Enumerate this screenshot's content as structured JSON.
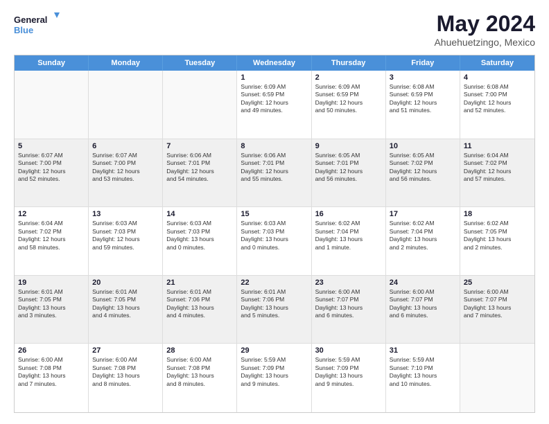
{
  "logo": {
    "line1": "General",
    "line2": "Blue"
  },
  "title": "May 2024",
  "subtitle": "Ahuehuetzingo, Mexico",
  "days": [
    "Sunday",
    "Monday",
    "Tuesday",
    "Wednesday",
    "Thursday",
    "Friday",
    "Saturday"
  ],
  "weeks": [
    [
      {
        "day": "",
        "info": ""
      },
      {
        "day": "",
        "info": ""
      },
      {
        "day": "",
        "info": ""
      },
      {
        "day": "1",
        "info": "Sunrise: 6:09 AM\nSunset: 6:59 PM\nDaylight: 12 hours\nand 49 minutes."
      },
      {
        "day": "2",
        "info": "Sunrise: 6:09 AM\nSunset: 6:59 PM\nDaylight: 12 hours\nand 50 minutes."
      },
      {
        "day": "3",
        "info": "Sunrise: 6:08 AM\nSunset: 6:59 PM\nDaylight: 12 hours\nand 51 minutes."
      },
      {
        "day": "4",
        "info": "Sunrise: 6:08 AM\nSunset: 7:00 PM\nDaylight: 12 hours\nand 52 minutes."
      }
    ],
    [
      {
        "day": "5",
        "info": "Sunrise: 6:07 AM\nSunset: 7:00 PM\nDaylight: 12 hours\nand 52 minutes."
      },
      {
        "day": "6",
        "info": "Sunrise: 6:07 AM\nSunset: 7:00 PM\nDaylight: 12 hours\nand 53 minutes."
      },
      {
        "day": "7",
        "info": "Sunrise: 6:06 AM\nSunset: 7:01 PM\nDaylight: 12 hours\nand 54 minutes."
      },
      {
        "day": "8",
        "info": "Sunrise: 6:06 AM\nSunset: 7:01 PM\nDaylight: 12 hours\nand 55 minutes."
      },
      {
        "day": "9",
        "info": "Sunrise: 6:05 AM\nSunset: 7:01 PM\nDaylight: 12 hours\nand 56 minutes."
      },
      {
        "day": "10",
        "info": "Sunrise: 6:05 AM\nSunset: 7:02 PM\nDaylight: 12 hours\nand 56 minutes."
      },
      {
        "day": "11",
        "info": "Sunrise: 6:04 AM\nSunset: 7:02 PM\nDaylight: 12 hours\nand 57 minutes."
      }
    ],
    [
      {
        "day": "12",
        "info": "Sunrise: 6:04 AM\nSunset: 7:02 PM\nDaylight: 12 hours\nand 58 minutes."
      },
      {
        "day": "13",
        "info": "Sunrise: 6:03 AM\nSunset: 7:03 PM\nDaylight: 12 hours\nand 59 minutes."
      },
      {
        "day": "14",
        "info": "Sunrise: 6:03 AM\nSunset: 7:03 PM\nDaylight: 13 hours\nand 0 minutes."
      },
      {
        "day": "15",
        "info": "Sunrise: 6:03 AM\nSunset: 7:03 PM\nDaylight: 13 hours\nand 0 minutes."
      },
      {
        "day": "16",
        "info": "Sunrise: 6:02 AM\nSunset: 7:04 PM\nDaylight: 13 hours\nand 1 minute."
      },
      {
        "day": "17",
        "info": "Sunrise: 6:02 AM\nSunset: 7:04 PM\nDaylight: 13 hours\nand 2 minutes."
      },
      {
        "day": "18",
        "info": "Sunrise: 6:02 AM\nSunset: 7:05 PM\nDaylight: 13 hours\nand 2 minutes."
      }
    ],
    [
      {
        "day": "19",
        "info": "Sunrise: 6:01 AM\nSunset: 7:05 PM\nDaylight: 13 hours\nand 3 minutes."
      },
      {
        "day": "20",
        "info": "Sunrise: 6:01 AM\nSunset: 7:05 PM\nDaylight: 13 hours\nand 4 minutes."
      },
      {
        "day": "21",
        "info": "Sunrise: 6:01 AM\nSunset: 7:06 PM\nDaylight: 13 hours\nand 4 minutes."
      },
      {
        "day": "22",
        "info": "Sunrise: 6:01 AM\nSunset: 7:06 PM\nDaylight: 13 hours\nand 5 minutes."
      },
      {
        "day": "23",
        "info": "Sunrise: 6:00 AM\nSunset: 7:07 PM\nDaylight: 13 hours\nand 6 minutes."
      },
      {
        "day": "24",
        "info": "Sunrise: 6:00 AM\nSunset: 7:07 PM\nDaylight: 13 hours\nand 6 minutes."
      },
      {
        "day": "25",
        "info": "Sunrise: 6:00 AM\nSunset: 7:07 PM\nDaylight: 13 hours\nand 7 minutes."
      }
    ],
    [
      {
        "day": "26",
        "info": "Sunrise: 6:00 AM\nSunset: 7:08 PM\nDaylight: 13 hours\nand 7 minutes."
      },
      {
        "day": "27",
        "info": "Sunrise: 6:00 AM\nSunset: 7:08 PM\nDaylight: 13 hours\nand 8 minutes."
      },
      {
        "day": "28",
        "info": "Sunrise: 6:00 AM\nSunset: 7:08 PM\nDaylight: 13 hours\nand 8 minutes."
      },
      {
        "day": "29",
        "info": "Sunrise: 5:59 AM\nSunset: 7:09 PM\nDaylight: 13 hours\nand 9 minutes."
      },
      {
        "day": "30",
        "info": "Sunrise: 5:59 AM\nSunset: 7:09 PM\nDaylight: 13 hours\nand 9 minutes."
      },
      {
        "day": "31",
        "info": "Sunrise: 5:59 AM\nSunset: 7:10 PM\nDaylight: 13 hours\nand 10 minutes."
      },
      {
        "day": "",
        "info": ""
      }
    ]
  ]
}
